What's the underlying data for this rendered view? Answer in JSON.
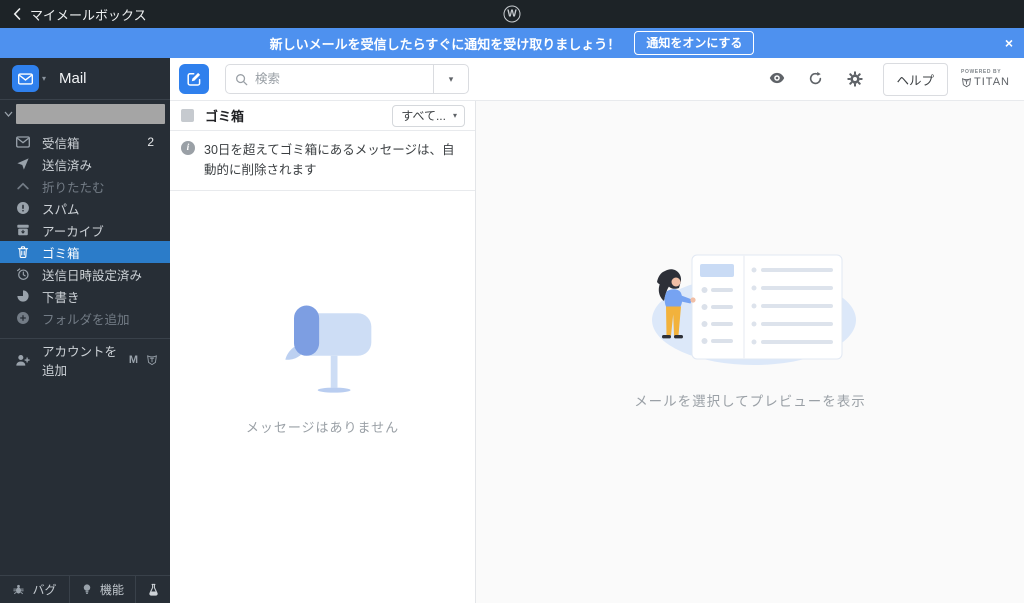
{
  "topbar": {
    "back_label": "マイメールボックス",
    "wp_letter": "W"
  },
  "banner": {
    "message": "新しいメールを受信したらすぐに通知を受け取りましょう！",
    "button_label": "通知をオンにする",
    "close_glyph": "×"
  },
  "sidebar": {
    "app_name": "Mail",
    "logo_caret": "▾",
    "folders": [
      {
        "label": "受信箱",
        "count": "2"
      },
      {
        "label": "送信済み"
      },
      {
        "label": "折りたたむ"
      },
      {
        "label": "スパム"
      },
      {
        "label": "アーカイブ"
      },
      {
        "label": "ゴミ箱"
      },
      {
        "label": "送信日時設定済み"
      },
      {
        "label": "下書き"
      },
      {
        "label": "フォルダを追加"
      }
    ],
    "add_account_label": "アカウントを追加",
    "gmail_letter": "M",
    "footer": {
      "bug": "バグ",
      "feature": "機能"
    }
  },
  "toolbar": {
    "search_placeholder": "検索",
    "search_caret": "▾",
    "help_label": "ヘルプ",
    "powered_by": "POWERED BY",
    "brand": "TITAN"
  },
  "list": {
    "title": "ゴミ箱",
    "filter_label": "すべて...",
    "filter_caret": "▾",
    "info_message": "30日を超えてゴミ箱にあるメッセージは、自動的に削除されます",
    "info_glyph": "i",
    "empty_message": "メッセージはありません"
  },
  "preview": {
    "empty_message": "メールを選択してプレビューを表示"
  },
  "colors": {
    "accent_blue": "#2f80ed",
    "banner_blue": "#4e91ef",
    "selected_blue": "#2b7cc9",
    "topbar_dark": "#1d2327",
    "sidebar_dark": "#272e36"
  }
}
